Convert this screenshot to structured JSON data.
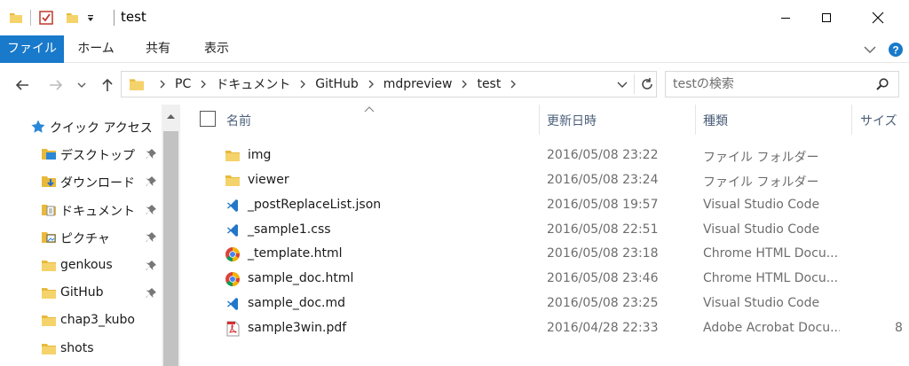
{
  "window": {
    "title": "test"
  },
  "ribbon": {
    "tabs": [
      {
        "label": "ファイル",
        "active": true
      },
      {
        "label": "ホーム",
        "active": false
      },
      {
        "label": "共有",
        "active": false
      },
      {
        "label": "表示",
        "active": false
      }
    ]
  },
  "address": {
    "crumbs": [
      "PC",
      "ドキュメント",
      "GitHub",
      "mdpreview",
      "test"
    ]
  },
  "search": {
    "placeholder": "testの検索"
  },
  "navpane": {
    "items": [
      {
        "label": "クイック アクセス",
        "icon": "star-icon",
        "pinned": false
      },
      {
        "label": "デスクトップ",
        "icon": "desktop-folder-icon",
        "pinned": true
      },
      {
        "label": "ダウンロード",
        "icon": "download-folder-icon",
        "pinned": true
      },
      {
        "label": "ドキュメント",
        "icon": "documents-folder-icon",
        "pinned": true
      },
      {
        "label": "ピクチャ",
        "icon": "pictures-folder-icon",
        "pinned": true
      },
      {
        "label": "genkous",
        "icon": "folder-icon",
        "pinned": true
      },
      {
        "label": "GitHub",
        "icon": "folder-icon",
        "pinned": true
      },
      {
        "label": "chap3_kubo",
        "icon": "folder-icon",
        "pinned": false
      },
      {
        "label": "shots",
        "icon": "folder-icon",
        "pinned": false
      }
    ]
  },
  "columns": {
    "name": "名前",
    "date": "更新日時",
    "type": "種類",
    "size": "サイズ"
  },
  "files": [
    {
      "name": "img",
      "date": "2016/05/08 23:22",
      "type": "ファイル フォルダー",
      "icon": "folder-icon"
    },
    {
      "name": "viewer",
      "date": "2016/05/08 23:24",
      "type": "ファイル フォルダー",
      "icon": "folder-icon"
    },
    {
      "name": "_postReplaceList.json",
      "date": "2016/05/08 19:57",
      "type": "Visual Studio Code",
      "icon": "vscode-icon"
    },
    {
      "name": "_sample1.css",
      "date": "2016/05/08 22:51",
      "type": "Visual Studio Code",
      "icon": "vscode-icon"
    },
    {
      "name": "_template.html",
      "date": "2016/05/08 23:18",
      "type": "Chrome HTML Docu...",
      "icon": "chrome-icon"
    },
    {
      "name": "sample_doc.html",
      "date": "2016/05/08 23:46",
      "type": "Chrome HTML Docu...",
      "icon": "chrome-icon"
    },
    {
      "name": "sample_doc.md",
      "date": "2016/05/08 23:25",
      "type": "Visual Studio Code",
      "icon": "vscode-icon"
    },
    {
      "name": "sample3win.pdf",
      "date": "2016/04/28 22:33",
      "type": "Adobe Acrobat Docu...",
      "icon": "pdf-icon",
      "size": "8"
    }
  ],
  "colors": {
    "accent": "#1979ca",
    "folder": "#e8b93a",
    "vscode": "#2277c9"
  }
}
